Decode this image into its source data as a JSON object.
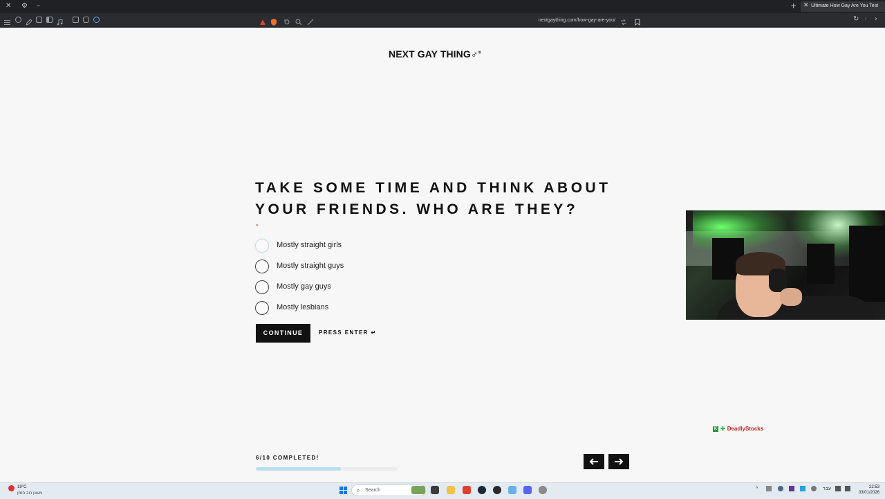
{
  "browser": {
    "tab_title": "Ultimate How Gay Are You Test",
    "url": "nextgaything.com/how-gay-are-you/"
  },
  "page": {
    "logo": "NEXT GAY THING",
    "logo_symbol": "♂",
    "logo_mark": "®",
    "question_line1": "TAKE SOME TIME AND THINK ABOUT",
    "question_line2": "YOUR FRIENDS. WHO ARE THEY?",
    "required_marker": "*",
    "options": [
      {
        "label": "Mostly straight girls",
        "selected": false
      },
      {
        "label": "Mostly straight guys",
        "selected": false
      },
      {
        "label": "Mostly gay guys",
        "selected": false
      },
      {
        "label": "Mostly lesbians",
        "selected": false
      }
    ],
    "continue_label": "CONTINUE",
    "press_enter": "PRESS ENTER ↵",
    "progress_text": "6/10 COMPLETED!",
    "progress_value": 0.6,
    "prev_arrow": "🡐",
    "next_arrow": "🡒"
  },
  "overlay": {
    "streamer_badge": "K",
    "streamer_plus": "✚",
    "streamer_name": "DeadlyStocks"
  },
  "taskbar": {
    "weather_temp": "19°C",
    "weather_desc": "מעונן רוב הזמן",
    "search_placeholder": "Search",
    "lang": "עבר",
    "time": "22:53",
    "date": "03/01/2026"
  },
  "colors": {
    "accent": "#111111",
    "progress_fill": "#bcdff0",
    "required": "#dd3333",
    "streamer_name": "#c92020"
  }
}
